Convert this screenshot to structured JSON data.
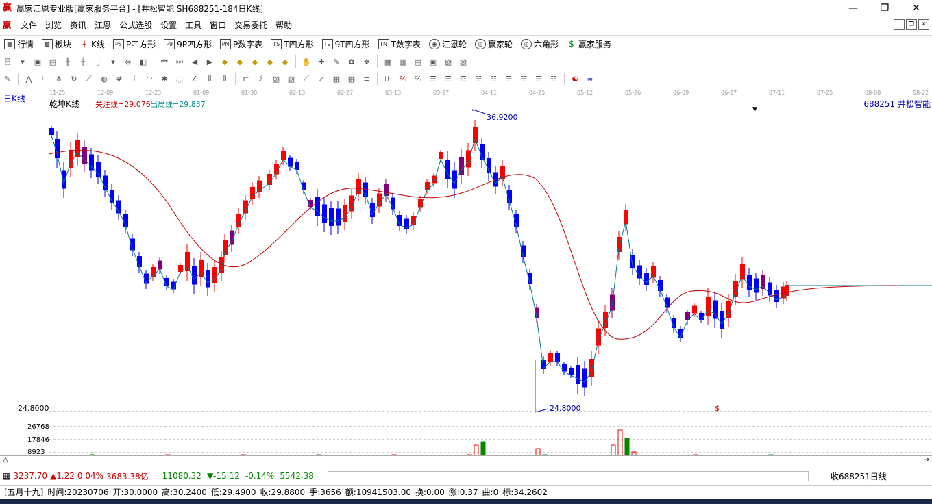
{
  "window": {
    "title": "赢家江恩专业版[赢家服务平台] - [井松智能  SH688251-184日K线]",
    "controls": [
      "—",
      "❐",
      "✕"
    ]
  },
  "menu": [
    "文件",
    "浏览",
    "资讯",
    "江恩",
    "公式选股",
    "设置",
    "工具",
    "窗口",
    "交易委托",
    "帮助"
  ],
  "toolbar1": [
    {
      "icon": "grid-icon",
      "label": "行情"
    },
    {
      "icon": "blocks-icon",
      "label": "板块"
    },
    {
      "icon": "candle-icon",
      "label": "K线"
    },
    {
      "icon": "ps-icon",
      "label": "P四方形"
    },
    {
      "icon": "p9-icon",
      "label": "9P四方形"
    },
    {
      "icon": "pn-icon",
      "label": "P数字表"
    },
    {
      "icon": "ts-icon",
      "label": "T四方形"
    },
    {
      "icon": "t9-icon",
      "label": "9T四方形"
    },
    {
      "icon": "tn-icon",
      "label": "T数字表"
    },
    {
      "icon": "wheel-icon",
      "label": "江恩轮"
    },
    {
      "icon": "wheel2-icon",
      "label": "赢家轮"
    },
    {
      "icon": "hexagon-icon",
      "label": "六角形"
    },
    {
      "icon": "dollar-icon",
      "label": "赢家服务"
    }
  ],
  "date_axis": [
    "11-25",
    "12-09",
    "12-23",
    "01-09",
    "01-30",
    "02-13",
    "02-27",
    "03-13",
    "03-27",
    "04-11",
    "04-25",
    "05-12",
    "05-26",
    "06-09",
    "06-27",
    "07-11",
    "07-25",
    "08-08",
    "08-22"
  ],
  "chart": {
    "period_label": "日K线",
    "name_label": "乾坤K线",
    "indicator1": "关注线=29.076",
    "indicator2": "出局线=29.837",
    "stock": "688251  井松智能",
    "high_label": "36.9200",
    "low_label": "24.8000",
    "low_axis": "24.8000",
    "dollar_marker": "$",
    "colors": {
      "up": "#ff0000",
      "down": "#0000ff",
      "mixed": "#800080",
      "ma_fast": "#007a8a",
      "ma_slow": "#c00000",
      "vol_up": "#ff0000",
      "vol_down": "#008800"
    }
  },
  "volume": {
    "ticks": [
      "26768",
      "17846",
      "8923"
    ]
  },
  "status": {
    "sh_index": "3237.70",
    "sh_change": "▲1.22",
    "sh_pct": "0.04%",
    "sh_amount": "3683.38亿",
    "sz_index": "11080.32",
    "sz_change": "▼-15.12",
    "sz_pct": "-0.14%",
    "sz_amount": "5542.38",
    "right_label": "收688251日线"
  },
  "bottom": {
    "lunar": "[五月十九]",
    "time": "时间:20230706",
    "open": "开:30.0000",
    "high": "高:30.2400",
    "low": "低:29.4900",
    "close": "收:29.8800",
    "hand": "手:3656",
    "amount": "额:10941503.00",
    "turnover": "换:0.00",
    "rise": "涨:0.37",
    "curve": "曲:0",
    "mark": "标:34.2602"
  }
}
